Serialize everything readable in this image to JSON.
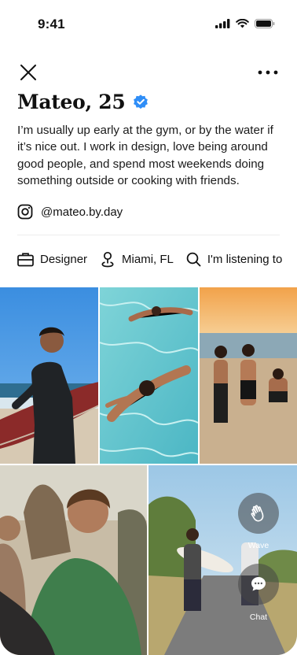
{
  "status": {
    "time": "9:41"
  },
  "profile": {
    "name": "Mateo, 25",
    "verified": true,
    "bio": "I’m usually up early at the gym, or by the water if it’s nice out. I work in design, love being around good people, and spend most weekends doing something outside or cooking with friends.",
    "instagram": "@mateo.by.day"
  },
  "meta": {
    "job": "Designer",
    "location": "Miami, FL",
    "listening": "I'm listening to"
  },
  "photos": [
    "surfer-with-board",
    "swimming-in-pool",
    "friends-on-beach",
    "friends-smiling",
    "walking-with-surfboard"
  ],
  "actions": {
    "wave": "Wave",
    "chat": "Chat"
  },
  "colors": {
    "verified": "#2f8ef7",
    "text": "#111111"
  }
}
